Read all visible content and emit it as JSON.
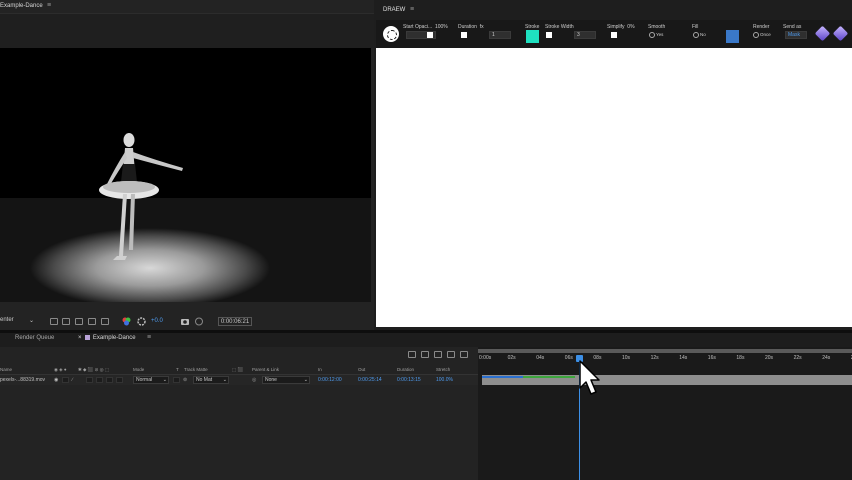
{
  "viewer": {
    "tab_title": "Example-Dance",
    "menu_icon": "≡",
    "view_select": "enter",
    "exposure": "+0.0",
    "timecode": "0:00:06:21"
  },
  "draew": {
    "title": "DRAEW",
    "menu_icon": "≡",
    "stroke_color": "#1fe0c0",
    "fill_color": "#3a78c8",
    "toolbar": {
      "start_opacity_label": "Start Opaci...",
      "start_opacity_value": "100%",
      "duration_label": "Duration",
      "duration_unit": "fx",
      "duration_value": "1",
      "stroke_label": "Stroke",
      "stroke_width_label": "Stroke Width",
      "stroke_width_value": "3",
      "simplify_label": "Simplify",
      "simplify_value": "0%",
      "smooth_label": "Smooth",
      "smooth_option": "Yes",
      "fill_label": "Fill",
      "fill_option": "No",
      "render_label": "Render",
      "render_option": "Once",
      "send_as_label": "Send as",
      "send_as_value": "Mask"
    }
  },
  "timeline": {
    "tabs": {
      "render_queue": "Render Queue",
      "comp_close": "×",
      "comp_name": "Example-Dance",
      "menu_icon": "≡"
    },
    "headers": {
      "name": "Name",
      "mode": "Mode",
      "t": "T",
      "track_matte": "Track Matte",
      "parent_link": "Parent & Link",
      "in": "In",
      "out": "Out",
      "duration": "Duration",
      "stretch": "Stretch"
    },
    "layer": {
      "name": "pexels-...88319.mov",
      "mode": "Normal",
      "track_matte": "No Mat",
      "parent": "None",
      "in": "0:00:12:00",
      "out": "0:00:25:14",
      "duration": "0:00:13:15",
      "stretch": "100.0%"
    },
    "ruler_ticks": [
      "0:00s",
      "02s",
      "04s",
      "06s",
      "08s",
      "10s",
      "12s",
      "14s",
      "16s",
      "18s",
      "20s",
      "22s",
      "24s",
      "26"
    ],
    "colors": {
      "cti": "#3c8fe6",
      "layer_bar": "#8e8e8e",
      "accent_green": "#3da63d"
    }
  }
}
